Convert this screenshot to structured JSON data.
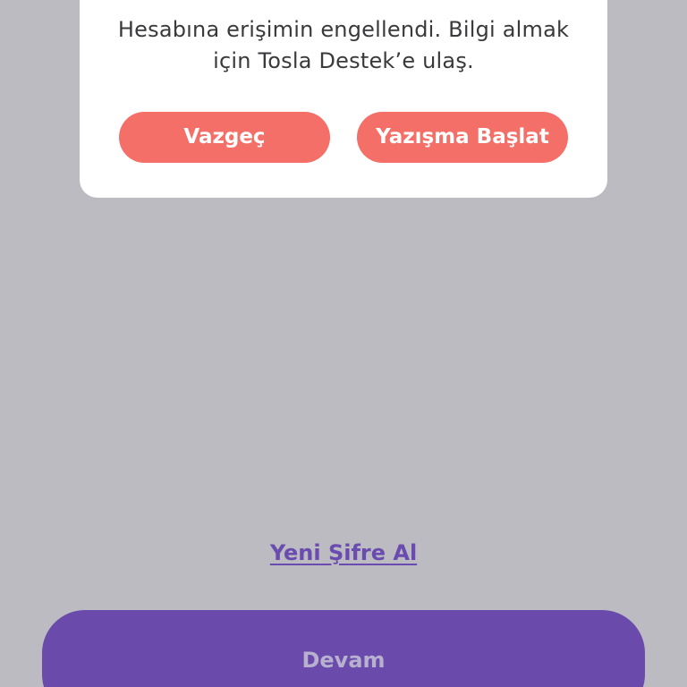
{
  "dialog": {
    "message": "Hesabına erişimin engellendi. Bilgi almak için Tosla Destek’e ulaş.",
    "cancel_label": "Vazgeç",
    "start_chat_label": "Yazışma Başlat"
  },
  "links": {
    "new_password": "Yeni Şifre Al"
  },
  "footer": {
    "continue_label": "Devam"
  },
  "colors": {
    "overlay": "#bcbbc1",
    "dialog_button": "#f36f67",
    "primary": "#6a4bab",
    "link": "#6a4bb0"
  }
}
